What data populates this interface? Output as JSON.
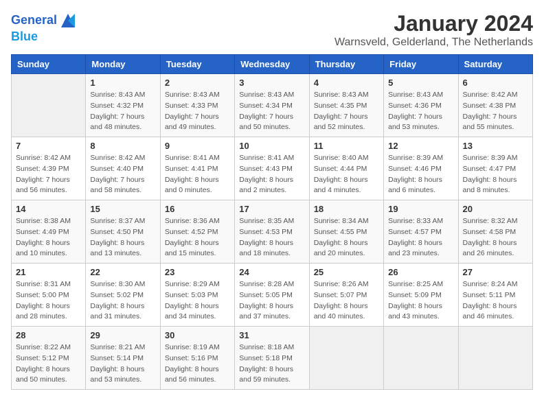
{
  "header": {
    "logo_line1": "General",
    "logo_line2": "Blue",
    "title": "January 2024",
    "subtitle": "Warnsveld, Gelderland, The Netherlands"
  },
  "days_of_week": [
    "Sunday",
    "Monday",
    "Tuesday",
    "Wednesday",
    "Thursday",
    "Friday",
    "Saturday"
  ],
  "weeks": [
    [
      {
        "num": "",
        "sunrise": "",
        "sunset": "",
        "daylight": ""
      },
      {
        "num": "1",
        "sunrise": "Sunrise: 8:43 AM",
        "sunset": "Sunset: 4:32 PM",
        "daylight": "Daylight: 7 hours and 48 minutes."
      },
      {
        "num": "2",
        "sunrise": "Sunrise: 8:43 AM",
        "sunset": "Sunset: 4:33 PM",
        "daylight": "Daylight: 7 hours and 49 minutes."
      },
      {
        "num": "3",
        "sunrise": "Sunrise: 8:43 AM",
        "sunset": "Sunset: 4:34 PM",
        "daylight": "Daylight: 7 hours and 50 minutes."
      },
      {
        "num": "4",
        "sunrise": "Sunrise: 8:43 AM",
        "sunset": "Sunset: 4:35 PM",
        "daylight": "Daylight: 7 hours and 52 minutes."
      },
      {
        "num": "5",
        "sunrise": "Sunrise: 8:43 AM",
        "sunset": "Sunset: 4:36 PM",
        "daylight": "Daylight: 7 hours and 53 minutes."
      },
      {
        "num": "6",
        "sunrise": "Sunrise: 8:42 AM",
        "sunset": "Sunset: 4:38 PM",
        "daylight": "Daylight: 7 hours and 55 minutes."
      }
    ],
    [
      {
        "num": "7",
        "sunrise": "Sunrise: 8:42 AM",
        "sunset": "Sunset: 4:39 PM",
        "daylight": "Daylight: 7 hours and 56 minutes."
      },
      {
        "num": "8",
        "sunrise": "Sunrise: 8:42 AM",
        "sunset": "Sunset: 4:40 PM",
        "daylight": "Daylight: 7 hours and 58 minutes."
      },
      {
        "num": "9",
        "sunrise": "Sunrise: 8:41 AM",
        "sunset": "Sunset: 4:41 PM",
        "daylight": "Daylight: 8 hours and 0 minutes."
      },
      {
        "num": "10",
        "sunrise": "Sunrise: 8:41 AM",
        "sunset": "Sunset: 4:43 PM",
        "daylight": "Daylight: 8 hours and 2 minutes."
      },
      {
        "num": "11",
        "sunrise": "Sunrise: 8:40 AM",
        "sunset": "Sunset: 4:44 PM",
        "daylight": "Daylight: 8 hours and 4 minutes."
      },
      {
        "num": "12",
        "sunrise": "Sunrise: 8:39 AM",
        "sunset": "Sunset: 4:46 PM",
        "daylight": "Daylight: 8 hours and 6 minutes."
      },
      {
        "num": "13",
        "sunrise": "Sunrise: 8:39 AM",
        "sunset": "Sunset: 4:47 PM",
        "daylight": "Daylight: 8 hours and 8 minutes."
      }
    ],
    [
      {
        "num": "14",
        "sunrise": "Sunrise: 8:38 AM",
        "sunset": "Sunset: 4:49 PM",
        "daylight": "Daylight: 8 hours and 10 minutes."
      },
      {
        "num": "15",
        "sunrise": "Sunrise: 8:37 AM",
        "sunset": "Sunset: 4:50 PM",
        "daylight": "Daylight: 8 hours and 13 minutes."
      },
      {
        "num": "16",
        "sunrise": "Sunrise: 8:36 AM",
        "sunset": "Sunset: 4:52 PM",
        "daylight": "Daylight: 8 hours and 15 minutes."
      },
      {
        "num": "17",
        "sunrise": "Sunrise: 8:35 AM",
        "sunset": "Sunset: 4:53 PM",
        "daylight": "Daylight: 8 hours and 18 minutes."
      },
      {
        "num": "18",
        "sunrise": "Sunrise: 8:34 AM",
        "sunset": "Sunset: 4:55 PM",
        "daylight": "Daylight: 8 hours and 20 minutes."
      },
      {
        "num": "19",
        "sunrise": "Sunrise: 8:33 AM",
        "sunset": "Sunset: 4:57 PM",
        "daylight": "Daylight: 8 hours and 23 minutes."
      },
      {
        "num": "20",
        "sunrise": "Sunrise: 8:32 AM",
        "sunset": "Sunset: 4:58 PM",
        "daylight": "Daylight: 8 hours and 26 minutes."
      }
    ],
    [
      {
        "num": "21",
        "sunrise": "Sunrise: 8:31 AM",
        "sunset": "Sunset: 5:00 PM",
        "daylight": "Daylight: 8 hours and 28 minutes."
      },
      {
        "num": "22",
        "sunrise": "Sunrise: 8:30 AM",
        "sunset": "Sunset: 5:02 PM",
        "daylight": "Daylight: 8 hours and 31 minutes."
      },
      {
        "num": "23",
        "sunrise": "Sunrise: 8:29 AM",
        "sunset": "Sunset: 5:03 PM",
        "daylight": "Daylight: 8 hours and 34 minutes."
      },
      {
        "num": "24",
        "sunrise": "Sunrise: 8:28 AM",
        "sunset": "Sunset: 5:05 PM",
        "daylight": "Daylight: 8 hours and 37 minutes."
      },
      {
        "num": "25",
        "sunrise": "Sunrise: 8:26 AM",
        "sunset": "Sunset: 5:07 PM",
        "daylight": "Daylight: 8 hours and 40 minutes."
      },
      {
        "num": "26",
        "sunrise": "Sunrise: 8:25 AM",
        "sunset": "Sunset: 5:09 PM",
        "daylight": "Daylight: 8 hours and 43 minutes."
      },
      {
        "num": "27",
        "sunrise": "Sunrise: 8:24 AM",
        "sunset": "Sunset: 5:11 PM",
        "daylight": "Daylight: 8 hours and 46 minutes."
      }
    ],
    [
      {
        "num": "28",
        "sunrise": "Sunrise: 8:22 AM",
        "sunset": "Sunset: 5:12 PM",
        "daylight": "Daylight: 8 hours and 50 minutes."
      },
      {
        "num": "29",
        "sunrise": "Sunrise: 8:21 AM",
        "sunset": "Sunset: 5:14 PM",
        "daylight": "Daylight: 8 hours and 53 minutes."
      },
      {
        "num": "30",
        "sunrise": "Sunrise: 8:19 AM",
        "sunset": "Sunset: 5:16 PM",
        "daylight": "Daylight: 8 hours and 56 minutes."
      },
      {
        "num": "31",
        "sunrise": "Sunrise: 8:18 AM",
        "sunset": "Sunset: 5:18 PM",
        "daylight": "Daylight: 8 hours and 59 minutes."
      },
      {
        "num": "",
        "sunrise": "",
        "sunset": "",
        "daylight": ""
      },
      {
        "num": "",
        "sunrise": "",
        "sunset": "",
        "daylight": ""
      },
      {
        "num": "",
        "sunrise": "",
        "sunset": "",
        "daylight": ""
      }
    ]
  ]
}
